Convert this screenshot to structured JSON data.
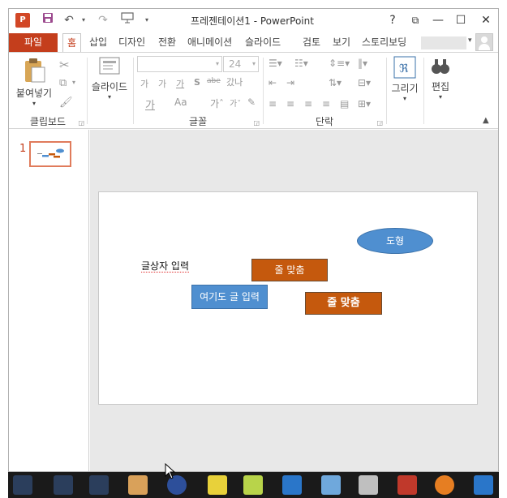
{
  "window": {
    "title": "프레젠테이션1 - PowerPoint",
    "app_icon": "P",
    "controls": {
      "help": "?",
      "restore": "⧉",
      "minimize": "—",
      "maximize": "☐",
      "close": "✕"
    }
  },
  "quick_access": {
    "icons": [
      "save-icon",
      "undo-icon",
      "redo-icon",
      "slideshow-icon",
      "customize-icon"
    ]
  },
  "tabs": {
    "file": "파일",
    "items": [
      "홈",
      "삽입",
      "디자인",
      "전환",
      "애니메이션",
      "슬라이드",
      "검토",
      "보기",
      "스토리보딩"
    ],
    "active": "홈"
  },
  "ribbon": {
    "clipboard": {
      "label": "클립보드",
      "paste": "붙여넣기"
    },
    "slides": {
      "label": "슬라이드",
      "btn": "슬라이드"
    },
    "font": {
      "label": "글꼴",
      "size": "24"
    },
    "paragraph": {
      "label": "단락"
    },
    "drawing": {
      "btn": "그리기"
    },
    "editing": {
      "btn": "편집"
    }
  },
  "thumbnails": [
    {
      "number": "1"
    }
  ],
  "slide": {
    "textbox": "글상자 입력",
    "shapes": {
      "ellipse": "도형",
      "orange1": "줄 맞춤",
      "blue1": "여기도 글 입력",
      "orange2": "줄 맞춤"
    }
  },
  "colors": {
    "accent": "#c43e1c",
    "shape_blue": "#4f8fd0",
    "shape_orange": "#c5590d"
  }
}
